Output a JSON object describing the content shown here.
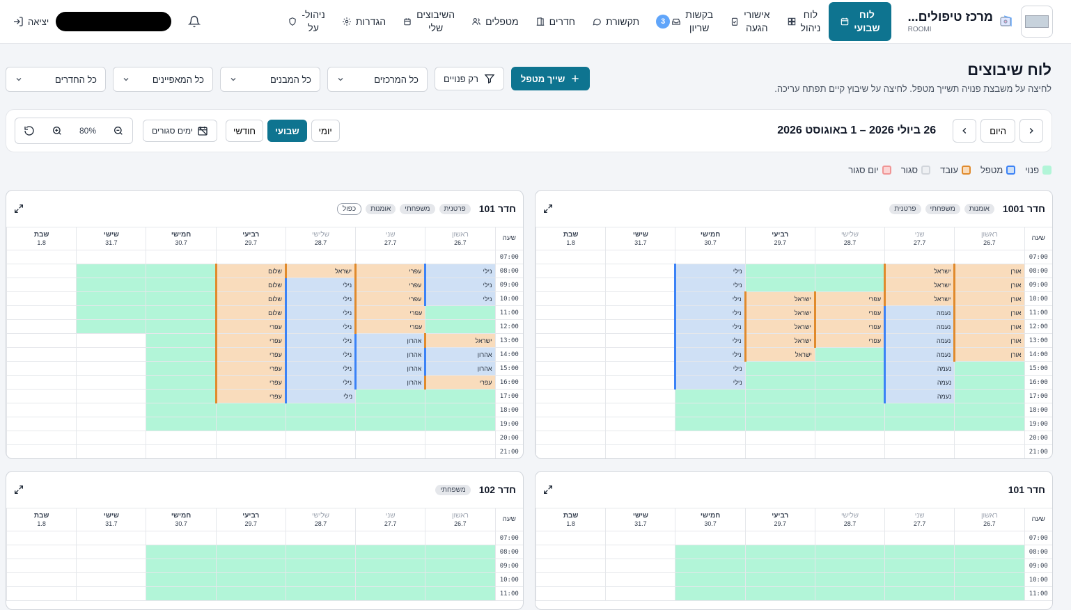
{
  "header": {
    "brand_name": "מרכז טיפולים...",
    "brand_sub": "ROOMI",
    "nav": [
      {
        "id": "weekly",
        "label": "לוח\nשבועי",
        "icon": "calendar-icon",
        "active": true
      },
      {
        "id": "board",
        "label": "לוח\nניהול",
        "icon": "grid-icon",
        "active": false
      },
      {
        "id": "arrivals",
        "label": "אישורי\nהגעה",
        "icon": "clipboard-check-icon",
        "active": false
      },
      {
        "id": "requests",
        "label": "בקשות\nשריון",
        "icon": "inbox-icon",
        "active": false,
        "badge": "3"
      },
      {
        "id": "comms",
        "label": "תקשורת",
        "icon": "chat-icon",
        "active": false
      },
      {
        "id": "rooms",
        "label": "חדרים",
        "icon": "door-icon",
        "active": false
      },
      {
        "id": "therapists",
        "label": "מטפלים",
        "icon": "users-icon",
        "active": false
      },
      {
        "id": "my",
        "label": "השיבוצים\nשלי",
        "icon": "calendar-small-icon",
        "active": false
      },
      {
        "id": "settings",
        "label": "הגדרות",
        "icon": "gear-icon",
        "active": false
      },
      {
        "id": "admin",
        "label": "ניהול-\nעל",
        "icon": "shield-icon",
        "active": false
      }
    ],
    "logout_label": "יציאה"
  },
  "page": {
    "title": "לוח שיבוצים",
    "subtitle": "לחיצה על משבצת פנויה תשייך מטפל. לחיצה על שיבוץ קיים תפתח עריכה."
  },
  "filters": {
    "assign_label": "שייך מטפל",
    "free_only_label": "רק פנויים",
    "selects": [
      "כל המרכזים",
      "כל המבנים",
      "כל המאפיינים",
      "כל החדרים"
    ]
  },
  "toolbar": {
    "today_label": "היום",
    "range": "26 ביולי 2026 – 1 באוגוסט 2026",
    "views": [
      {
        "label": "יומי",
        "active": false
      },
      {
        "label": "שבועי",
        "active": true
      },
      {
        "label": "חודשי",
        "active": false
      }
    ],
    "closed_days_label": "ימים סגורים",
    "zoom": "80%"
  },
  "legend": [
    {
      "label": "פנוי",
      "fill": "#b2f5d8",
      "border": "#b2f5d8"
    },
    {
      "label": "מטפל",
      "fill": "#cfe0f5",
      "border": "#3b82f6"
    },
    {
      "label": "עובד",
      "fill": "#f9dcbc",
      "border": "#e08a2c"
    },
    {
      "label": "סגור",
      "fill": "#eef0f3",
      "border": "#d1d5db"
    },
    {
      "label": "יום סגור",
      "fill": "#fbd5d5",
      "border": "#f09595"
    }
  ],
  "hour_header": "שעה",
  "days": [
    {
      "name": "ראשון",
      "date": "26.7",
      "past": true
    },
    {
      "name": "שני",
      "date": "27.7",
      "past": true
    },
    {
      "name": "שלישי",
      "date": "28.7",
      "past": true
    },
    {
      "name": "רביעי",
      "date": "29.7",
      "past": false
    },
    {
      "name": "חמישי",
      "date": "30.7",
      "past": false
    },
    {
      "name": "שישי",
      "date": "31.7",
      "past": false
    },
    {
      "name": "שבת",
      "date": "1.8",
      "past": false
    }
  ],
  "hours": [
    "07:00",
    "08:00",
    "09:00",
    "10:00",
    "11:00",
    "12:00",
    "13:00",
    "14:00",
    "15:00",
    "16:00",
    "17:00",
    "18:00",
    "19:00",
    "20:00",
    "21:00"
  ],
  "rooms": [
    {
      "title": "חדר 1001",
      "tags": [
        {
          "t": "אומנות"
        },
        {
          "t": "משפחתי"
        },
        {
          "t": "פרטנית"
        }
      ],
      "grid": [
        [
          "",
          "",
          "",
          "",
          "",
          "",
          ""
        ],
        [
          "w:אורן",
          "w:ישראל",
          "f",
          "f",
          "t:נילי",
          "",
          ""
        ],
        [
          "w:אורן",
          "w:ישראל",
          "f",
          "f",
          "t:נילי",
          "",
          ""
        ],
        [
          "w:אורן",
          "w:ישראל",
          "w:עפרי",
          "w:ישראל",
          "t:נילי",
          "",
          ""
        ],
        [
          "w:אורן",
          "t:נעמה",
          "w:עפרי",
          "w:ישראל",
          "t:נילי",
          "",
          ""
        ],
        [
          "w:אורן",
          "t:נעמה",
          "w:עפרי",
          "w:ישראל",
          "t:נילי",
          "",
          ""
        ],
        [
          "w:אורן",
          "t:נעמה",
          "w:עפרי",
          "w:ישראל",
          "t:נילי",
          "",
          ""
        ],
        [
          "w:אורן",
          "t:נעמה",
          "f",
          "w:ישראל",
          "t:נילי",
          "",
          ""
        ],
        [
          "f",
          "t:נעמה",
          "f",
          "f",
          "t:נילי",
          "",
          ""
        ],
        [
          "f",
          "t:נעמה",
          "f",
          "f",
          "t:נילי",
          "",
          ""
        ],
        [
          "f",
          "t:נעמה",
          "f",
          "f",
          "f",
          "",
          ""
        ],
        [
          "f",
          "f",
          "f",
          "f",
          "f",
          "",
          ""
        ],
        [
          "f",
          "f",
          "f",
          "f",
          "f",
          "",
          ""
        ],
        [
          "",
          "",
          "",
          "",
          "",
          "",
          ""
        ],
        [
          "",
          "",
          "",
          "",
          "",
          "",
          ""
        ]
      ]
    },
    {
      "title": "חדר 101",
      "tags": [
        {
          "t": "פרטנית"
        },
        {
          "t": "משפחתי"
        },
        {
          "t": "אומנות"
        },
        {
          "t": "כפול",
          "outline": true
        }
      ],
      "grid": [
        [
          "",
          "",
          "",
          "",
          "",
          "",
          ""
        ],
        [
          "t:נילי",
          "w:עפרי",
          "w:ישראל",
          "w:שלום",
          "f",
          "f",
          ""
        ],
        [
          "t:נילי",
          "w:עפרי",
          "t:נילי",
          "w:שלום",
          "f",
          "f",
          ""
        ],
        [
          "t:נילי",
          "w:עפרי",
          "t:נילי",
          "w:שלום",
          "f",
          "f",
          ""
        ],
        [
          "f",
          "w:עפרי",
          "t:נילי",
          "w:שלום",
          "f",
          "f",
          ""
        ],
        [
          "f",
          "w:עפרי",
          "t:נילי",
          "w:עפרי",
          "f",
          "f",
          ""
        ],
        [
          "w:ישראל",
          "t:אהרון",
          "t:נילי",
          "w:עפרי",
          "f",
          "",
          ""
        ],
        [
          "t:אהרון",
          "t:אהרון",
          "t:נילי",
          "w:עפרי",
          "f",
          "",
          ""
        ],
        [
          "t:אהרון",
          "t:אהרון",
          "t:נילי",
          "w:עפרי",
          "f",
          "",
          ""
        ],
        [
          "w:עפרי",
          "t:אהרון",
          "t:נילי",
          "w:עפרי",
          "f",
          "",
          ""
        ],
        [
          "f",
          "f",
          "t:נילי",
          "w:עפרי",
          "f",
          "",
          ""
        ],
        [
          "f",
          "f",
          "f",
          "f",
          "f",
          "",
          ""
        ],
        [
          "f",
          "f",
          "f",
          "f",
          "f",
          "",
          ""
        ],
        [
          "",
          "",
          "",
          "",
          "",
          "",
          ""
        ],
        [
          "",
          "",
          "",
          "",
          "",
          "",
          ""
        ]
      ]
    },
    {
      "title": "חדר 101",
      "tags": [],
      "grid": [
        [
          "",
          "",
          "",
          "",
          "",
          "",
          ""
        ],
        [
          "f",
          "f",
          "f",
          "f",
          "f",
          "",
          ""
        ],
        [
          "f",
          "f",
          "f",
          "f",
          "f",
          "",
          ""
        ],
        [
          "f",
          "f",
          "f",
          "f",
          "f",
          "",
          ""
        ],
        [
          "f",
          "f",
          "f",
          "f",
          "f",
          "",
          ""
        ]
      ]
    },
    {
      "title": "חדר 102",
      "tags": [
        {
          "t": "משפחתי"
        }
      ],
      "grid": [
        [
          "",
          "",
          "",
          "",
          "",
          "",
          ""
        ],
        [
          "f",
          "f",
          "f",
          "f",
          "f",
          "",
          ""
        ],
        [
          "f",
          "f",
          "f",
          "f",
          "f",
          "",
          ""
        ],
        [
          "f",
          "f",
          "f",
          "f",
          "f",
          "",
          ""
        ],
        [
          "f",
          "f",
          "f",
          "f",
          "f",
          "",
          ""
        ]
      ]
    }
  ]
}
